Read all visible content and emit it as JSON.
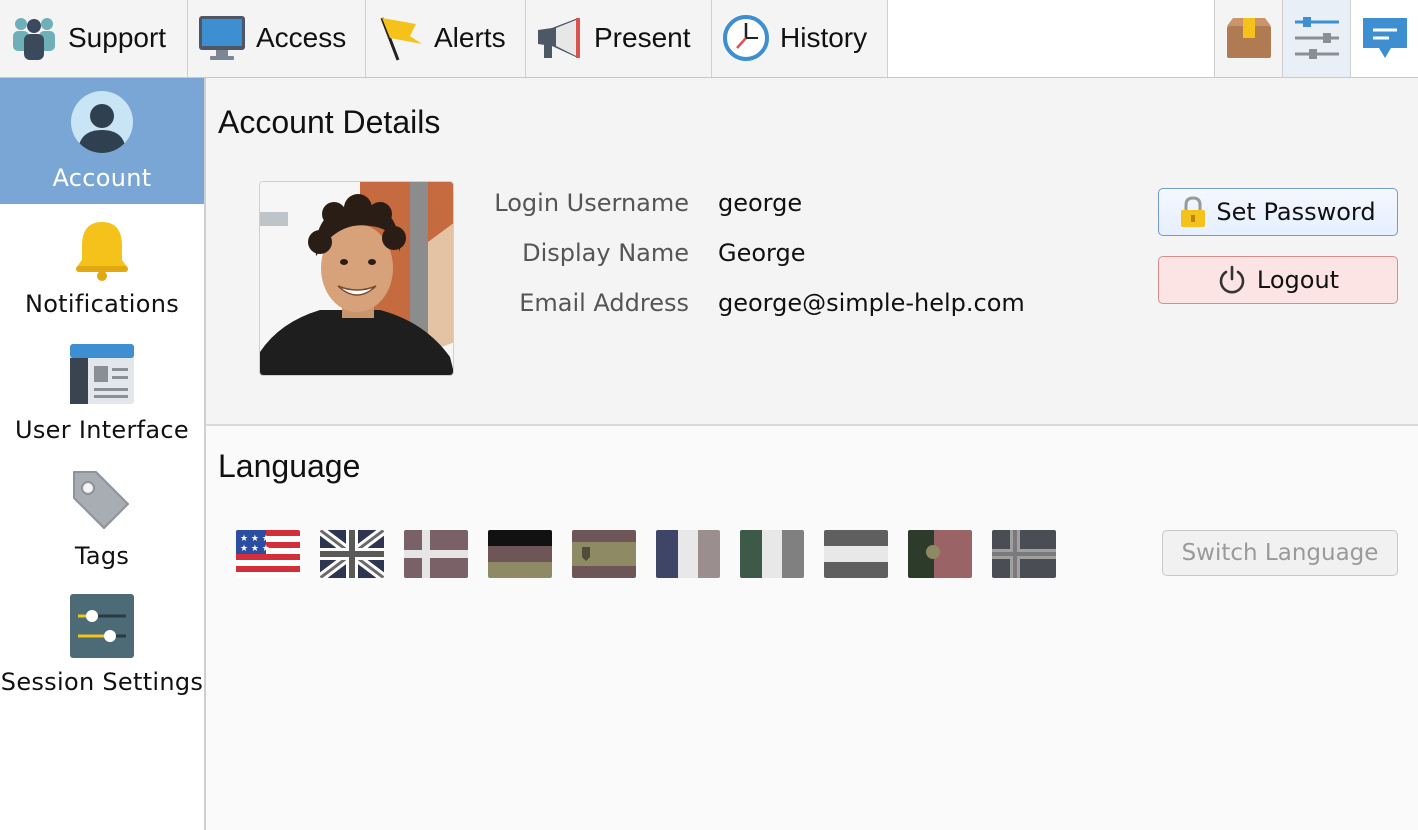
{
  "toolbar": {
    "tabs": [
      {
        "label": "Support",
        "icon": "people-icon"
      },
      {
        "label": "Access",
        "icon": "monitor-icon"
      },
      {
        "label": "Alerts",
        "icon": "flag-icon"
      },
      {
        "label": "Present",
        "icon": "megaphone-icon"
      },
      {
        "label": "History",
        "icon": "clock-icon"
      }
    ],
    "tools": [
      {
        "icon": "package-icon"
      },
      {
        "icon": "settings-sliders-icon",
        "active": true
      },
      {
        "icon": "chat-icon"
      }
    ]
  },
  "sidebar": {
    "items": [
      {
        "label": "Account",
        "icon": "user-avatar-icon",
        "active": true
      },
      {
        "label": "Notifications",
        "icon": "bell-icon"
      },
      {
        "label": "User Interface",
        "icon": "window-layout-icon"
      },
      {
        "label": "Tags",
        "icon": "tag-icon"
      },
      {
        "label": "Session Settings",
        "icon": "sliders-icon"
      }
    ]
  },
  "account": {
    "title": "Account Details",
    "fields": [
      {
        "label": "Login Username",
        "value": "george"
      },
      {
        "label": "Display Name",
        "value": "George"
      },
      {
        "label": "Email Address",
        "value": "george@simple-help.com"
      }
    ],
    "set_password_label": "Set Password",
    "logout_label": "Logout"
  },
  "language": {
    "title": "Language",
    "flags": [
      "us-flag",
      "uk-flag",
      "cross-flag",
      "tricolor-flag",
      "crest-flag",
      "vertical-tricolor-flag",
      "green-tricolor-flag",
      "horizontal-tricolor-flag",
      "circle-flag",
      "nordic-cross-flag"
    ],
    "selected_flag": "us-flag",
    "switch_label": "Switch Language"
  },
  "colors": {
    "accent": "#7aa6d6",
    "sidebar_active": "#7aa6d6",
    "logout_bg": "#fde4e4",
    "password_border": "#6f9bd9"
  }
}
